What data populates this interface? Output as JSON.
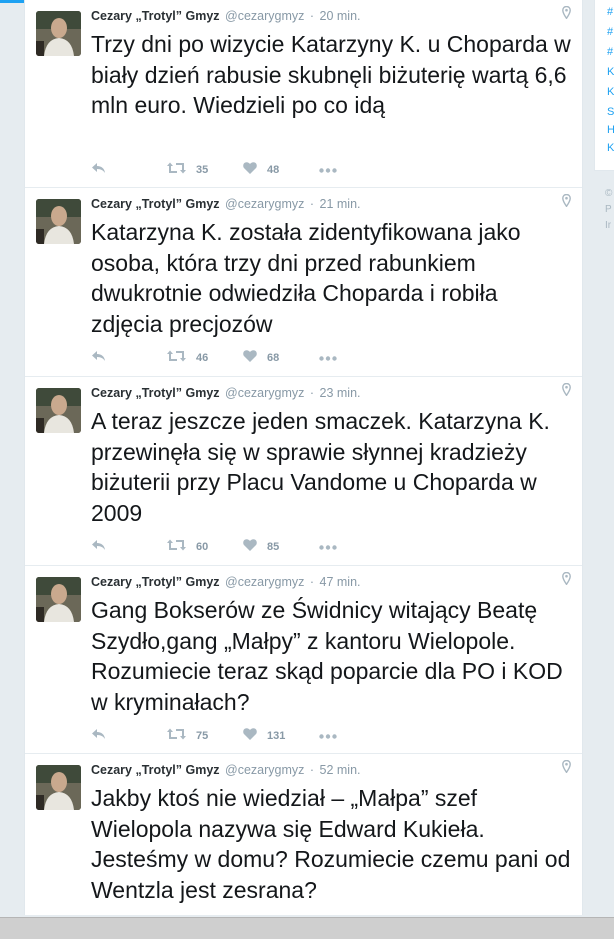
{
  "colors": {
    "accent": "#1da1f2",
    "text": "#14171a",
    "muted": "#8899a6"
  },
  "right_panel": {
    "items": [
      "#",
      "#",
      "#",
      "K",
      "K",
      "S",
      "H",
      "K"
    ],
    "footer": [
      "©",
      "P",
      "Ir"
    ]
  },
  "tweets": [
    {
      "name": "Cezary „Trotyl” Gmyz",
      "handle": "@cezarygmyz",
      "time": "20 min.",
      "text": "Trzy dni po wizycie Katarzyny K. u Choparda w biały dzień rabusie skubnęli biżuterię wartą 6,6 mln euro. Wiedzieli po co idą",
      "retweets": "35",
      "likes": "48"
    },
    {
      "name": "Cezary „Trotyl” Gmyz",
      "handle": "@cezarygmyz",
      "time": "21 min.",
      "text": "Katarzyna K. została zidentyfikowana jako osoba, która trzy dni przed rabunkiem dwukrotnie odwiedziła Choparda i robiła zdjęcia precjozów",
      "retweets": "46",
      "likes": "68"
    },
    {
      "name": "Cezary „Trotyl” Gmyz",
      "handle": "@cezarygmyz",
      "time": "23 min.",
      "text": "A teraz jeszcze jeden smaczek. Katarzyna K. przewinęła się w sprawie słynnej kradzieży biżuterii przy Placu Vandome u Choparda w 2009",
      "retweets": "60",
      "likes": "85"
    },
    {
      "name": "Cezary „Trotyl” Gmyz",
      "handle": "@cezarygmyz",
      "time": "47 min.",
      "text": "Gang Bokserów ze Świdnicy witający Beatę Szydło,gang „Małpy” z kantoru Wielopole. Rozumiecie teraz skąd poparcie dla PO i KOD w kryminałach?",
      "retweets": "75",
      "likes": "131"
    },
    {
      "name": "Cezary „Trotyl” Gmyz",
      "handle": "@cezarygmyz",
      "time": "52 min.",
      "text": "Jakby ktoś nie wiedział – „Małpa” szef Wielopola nazywa się Edward Kukieła. Jesteśmy w domu? Rozumiecie czemu pani od Wentzla jest zesrana?",
      "retweets": "",
      "likes": ""
    }
  ]
}
